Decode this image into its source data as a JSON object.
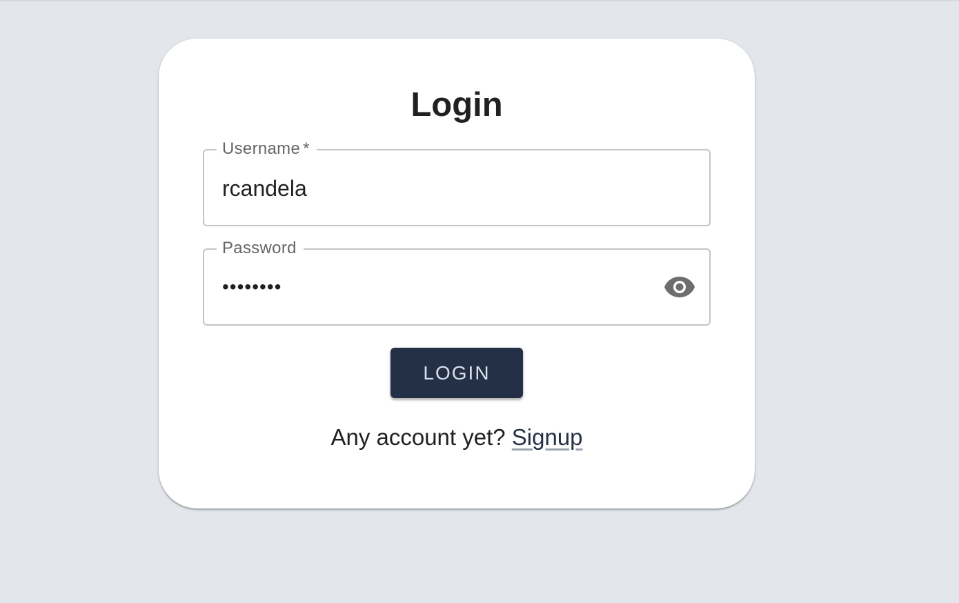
{
  "title": "Login",
  "form": {
    "username": {
      "label": "Username",
      "required_mark": "*",
      "value": "rcandela"
    },
    "password": {
      "label": "Password",
      "masked_value": "••••••••",
      "toggle_icon": "eye-icon"
    },
    "login_button": "LOGIN"
  },
  "signup": {
    "prompt": "Any account yet?",
    "link_text": "Signup"
  },
  "colors": {
    "background": "#e3e7ec",
    "card": "#ffffff",
    "button_bg": "#243046",
    "button_text": "#d9e1ec"
  }
}
